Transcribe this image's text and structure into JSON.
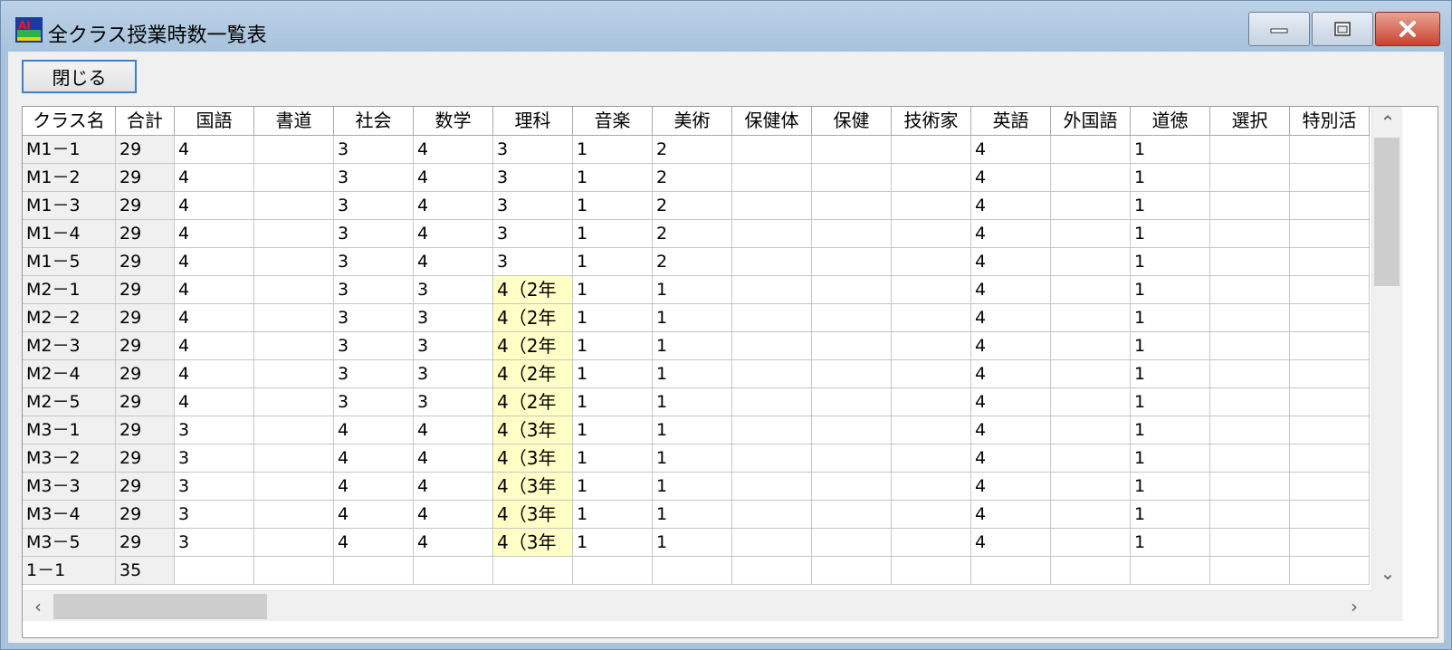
{
  "window": {
    "title": "全クラス授業時数一覧表"
  },
  "toolbar": {
    "close_label": "閉じる"
  },
  "icons": {
    "minimize": "minimize-icon",
    "maximize": "maximize-icon",
    "close": "close-icon",
    "scroll_up": "chevron-up-icon",
    "scroll_down": "chevron-down-icon",
    "scroll_left": "chevron-left-icon",
    "scroll_right": "chevron-right-icon"
  },
  "grid": {
    "columns": [
      "クラス名",
      "合計",
      "国語",
      "書道",
      "社会",
      "数学",
      "理科",
      "音楽",
      "美術",
      "保健体",
      "保健",
      "技術家",
      "英語",
      "外国語",
      "道徳",
      "選択",
      "特別活"
    ],
    "rows": [
      [
        "M1－1",
        "29",
        "4",
        "",
        "3",
        "4",
        "3",
        "1",
        "2",
        "",
        "",
        "",
        "4",
        "",
        "1",
        "",
        ""
      ],
      [
        "M1－2",
        "29",
        "4",
        "",
        "3",
        "4",
        "3",
        "1",
        "2",
        "",
        "",
        "",
        "4",
        "",
        "1",
        "",
        ""
      ],
      [
        "M1－3",
        "29",
        "4",
        "",
        "3",
        "4",
        "3",
        "1",
        "2",
        "",
        "",
        "",
        "4",
        "",
        "1",
        "",
        ""
      ],
      [
        "M1－4",
        "29",
        "4",
        "",
        "3",
        "4",
        "3",
        "1",
        "2",
        "",
        "",
        "",
        "4",
        "",
        "1",
        "",
        ""
      ],
      [
        "M1－5",
        "29",
        "4",
        "",
        "3",
        "4",
        "3",
        "1",
        "2",
        "",
        "",
        "",
        "4",
        "",
        "1",
        "",
        ""
      ],
      [
        "M2－1",
        "29",
        "4",
        "",
        "3",
        "3",
        "4（2年",
        "1",
        "1",
        "",
        "",
        "",
        "4",
        "",
        "1",
        "",
        ""
      ],
      [
        "M2－2",
        "29",
        "4",
        "",
        "3",
        "3",
        "4（2年",
        "1",
        "1",
        "",
        "",
        "",
        "4",
        "",
        "1",
        "",
        ""
      ],
      [
        "M2－3",
        "29",
        "4",
        "",
        "3",
        "3",
        "4（2年",
        "1",
        "1",
        "",
        "",
        "",
        "4",
        "",
        "1",
        "",
        ""
      ],
      [
        "M2－4",
        "29",
        "4",
        "",
        "3",
        "3",
        "4（2年",
        "1",
        "1",
        "",
        "",
        "",
        "4",
        "",
        "1",
        "",
        ""
      ],
      [
        "M2－5",
        "29",
        "4",
        "",
        "3",
        "3",
        "4（2年",
        "1",
        "1",
        "",
        "",
        "",
        "4",
        "",
        "1",
        "",
        ""
      ],
      [
        "M3－1",
        "29",
        "3",
        "",
        "4",
        "4",
        "4（3年",
        "1",
        "1",
        "",
        "",
        "",
        "4",
        "",
        "1",
        "",
        ""
      ],
      [
        "M3－2",
        "29",
        "3",
        "",
        "4",
        "4",
        "4（3年",
        "1",
        "1",
        "",
        "",
        "",
        "4",
        "",
        "1",
        "",
        ""
      ],
      [
        "M3－3",
        "29",
        "3",
        "",
        "4",
        "4",
        "4（3年",
        "1",
        "1",
        "",
        "",
        "",
        "4",
        "",
        "1",
        "",
        ""
      ],
      [
        "M3－4",
        "29",
        "3",
        "",
        "4",
        "4",
        "4（3年",
        "1",
        "1",
        "",
        "",
        "",
        "4",
        "",
        "1",
        "",
        ""
      ],
      [
        "M3－5",
        "29",
        "3",
        "",
        "4",
        "4",
        "4（3年",
        "1",
        "1",
        "",
        "",
        "",
        "4",
        "",
        "1",
        "",
        ""
      ],
      [
        "1－1",
        "35",
        "",
        "",
        "",
        "",
        "",
        "",
        "",
        "",
        "",
        "",
        "",
        "",
        "",
        "",
        ""
      ]
    ],
    "highlight_color": "#ffffc6"
  }
}
